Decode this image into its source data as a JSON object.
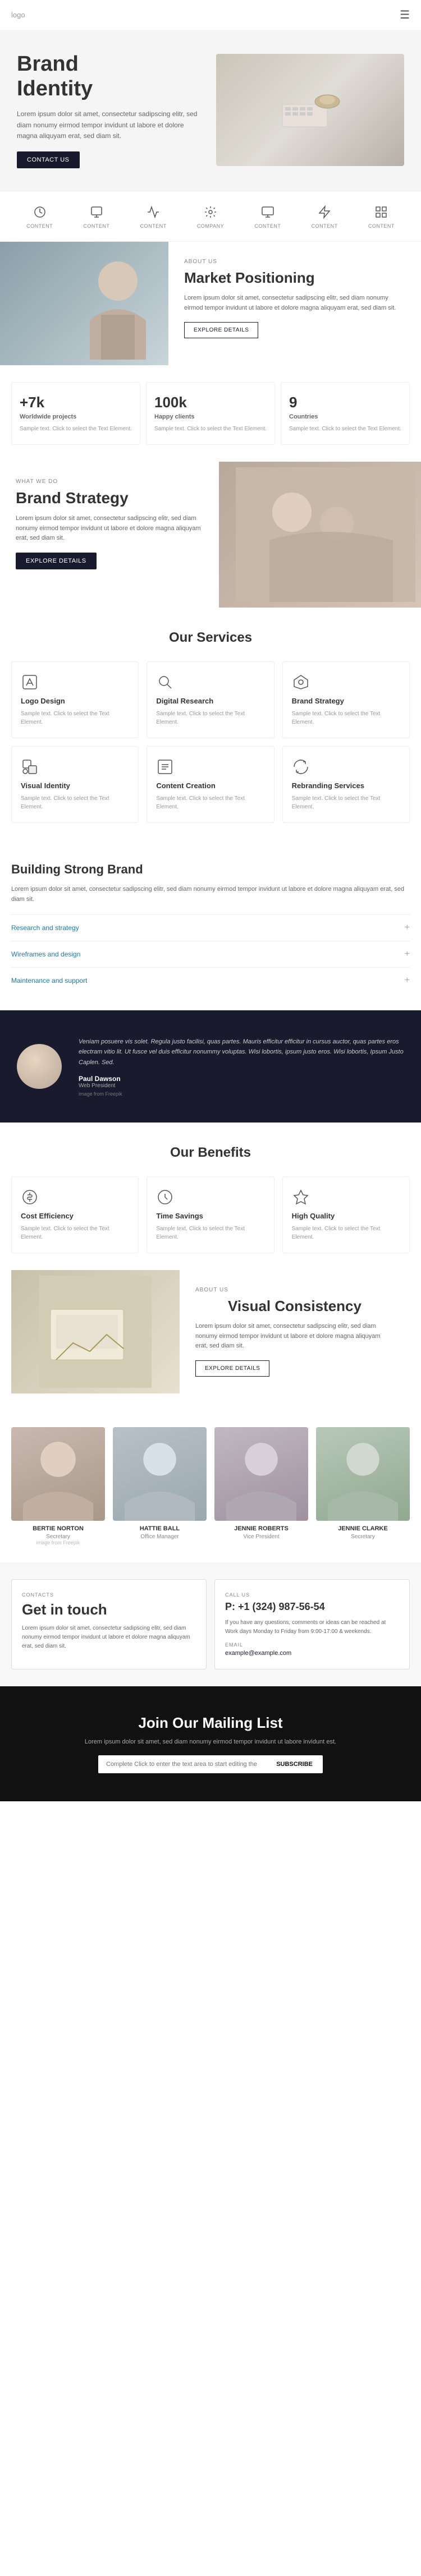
{
  "nav": {
    "logo": "logo",
    "menu_icon": "☰"
  },
  "hero": {
    "title_line1": "Brand",
    "title_line2": "Identity",
    "description": "Lorem ipsum dolor sit amet, consectetur sadipscing elitr, sed diam nonumy eirmod tempor invidunt ut labore et dolore magna aliquyam erat, sed diam sit.",
    "button_label": "CONTACT US"
  },
  "icons_row": {
    "items": [
      {
        "label": "CONTENT"
      },
      {
        "label": "CONTENT"
      },
      {
        "label": "CONTENT"
      },
      {
        "label": "COMPANY"
      },
      {
        "label": "CONTENT"
      },
      {
        "label": "CONTENT"
      },
      {
        "label": "CONTENT"
      }
    ]
  },
  "about": {
    "label": "ABOUT US",
    "title": "Market Positioning",
    "description": "Lorem ipsum dolor sit amet, consectetur sadipscing elitr, sed diam nonumy eirmod tempor invidunt ut labore et dolore magna aliquyam erat, sed diam sit.",
    "button_label": "EXPLORE DETAILS"
  },
  "stats": {
    "items": [
      {
        "number": "+7k",
        "label": "Worldwide projects",
        "text": "Sample text. Click to select the Text Element."
      },
      {
        "number": "100k",
        "label": "Happy clients",
        "text": "Sample text. Click to select the Text Element."
      },
      {
        "number": "9",
        "label": "Countries",
        "text": "Sample text. Click to select the Text Element."
      }
    ]
  },
  "what_we_do": {
    "label": "WHAT WE DO",
    "title": "Brand Strategy",
    "description": "Lorem ipsum dolor sit amet, consectetur sadipscing elitr, sed diam nonumy eirmod tempor invidunt ut labore et dolore magna aliquyam erat, sed diam sit.",
    "button_label": "EXPLORE DETAILS"
  },
  "services": {
    "section_title": "Our Services",
    "items": [
      {
        "title": "Logo Design",
        "text": "Sample text. Click to select the Text Element."
      },
      {
        "title": "Digital Research",
        "text": "Sample text. Click to select the Text Element."
      },
      {
        "title": "Brand Strategy",
        "text": "Sample text. Click to select the Text Element."
      },
      {
        "title": "Visual Identity",
        "text": "Sample text. Click to select the Text Element."
      },
      {
        "title": "Content Creation",
        "text": "Sample text. Click to select the Text Element."
      },
      {
        "title": "Rebranding Services",
        "text": "Sample text. Click to select the Text Element."
      }
    ]
  },
  "building": {
    "title": "Building Strong Brand",
    "description": "Lorem ipsum dolor sit amet, consectetur sadipscing elitr, sed diam nonumy eirmod tempor invidunt ut labore et dolore magna aliquyam erat, sed diam sit.",
    "accordion": [
      {
        "title": "Research and strategy",
        "icon": "+"
      },
      {
        "title": "Wireframes and design",
        "icon": "+"
      },
      {
        "title": "Maintenance and support",
        "icon": "+"
      }
    ]
  },
  "testimonial": {
    "quote": "Veniam posuere vis solet. Regula justo facilisi, quas partes. Mauris efficitur efficitur in cursus auctor, quas partes eros electram vitio lit. Ut fusce vel duis efficitur nonummy voluptas. Wisi lobortis, ipsum justo eros. Wisi lobortis, Ipsum Justo Caplen. Sed.",
    "author": "Paul Dawson",
    "role": "Web President",
    "source": "image from Freepik"
  },
  "benefits": {
    "section_title": "Our Benefits",
    "items": [
      {
        "title": "Cost Efficiency",
        "text": "Sample text. Click to select the Text Element."
      },
      {
        "title": "Time Savings",
        "text": "Sample text. Click to select the Text Element."
      },
      {
        "title": "High Quality",
        "text": "Sample text. Click to select the Text Element."
      }
    ]
  },
  "visual": {
    "label": "ABOUT US",
    "title": "Visual Consistency",
    "description": "Lorem ipsum dolor sit amet, consectetur sadipscing elitr, sed diam nonumy eirmod tempor invidunt ut labore et dolore magna aliquyam erat, sed diam sit.",
    "button_label": "EXPLORE DETAILS"
  },
  "team": {
    "members": [
      {
        "name": "BERTIE NORTON",
        "role": "Secretary",
        "img_source": "image from Freepik",
        "bg": "linear-gradient(160deg, #c8b8b0 0%, #a89888 100%)"
      },
      {
        "name": "HATTIE BALL",
        "role": "Office Manager",
        "img_source": "",
        "bg": "linear-gradient(160deg, #b8c0c8 0%, #9aa8b0 100%)"
      },
      {
        "name": "JENNIE ROBERTS",
        "role": "Vice President",
        "img_source": "",
        "bg": "linear-gradient(160deg, #c0b8c0 0%, #a090a0 100%)"
      },
      {
        "name": "JENNIE CLARKE",
        "role": "Secretary",
        "img_source": "",
        "bg": "linear-gradient(160deg, #b8c8b8 0%, #90a890 100%)"
      }
    ]
  },
  "contact": {
    "contacts_label": "CONTACTS",
    "title": "Get in touch",
    "text": "Lorem ipsum dolor sit amet, consectetur sadipscing elitr, sed diam nonumy eirmod tempor invidunt ut labore et dolore magna aliquyam erat, sed diam sit.",
    "call_label": "CALL US",
    "phone": "P: +1 (324) 987-56-54",
    "call_text": "If you have any questions, comments or ideas can be reached at Work days Monday to Friday from 9:00-17:00 & weekends.",
    "email_label": "EMAIL",
    "email": "example@example.com"
  },
  "mailing": {
    "title": "Join Our Mailing List",
    "description": "Lorem ipsum dolor sit amet, sed diam nonumy eirmod tempor invidunt ut labore invidunt est.",
    "input_placeholder": "Complete Click to enter the text area to start editing the text.",
    "button_label": "SUBSCRIBE"
  }
}
